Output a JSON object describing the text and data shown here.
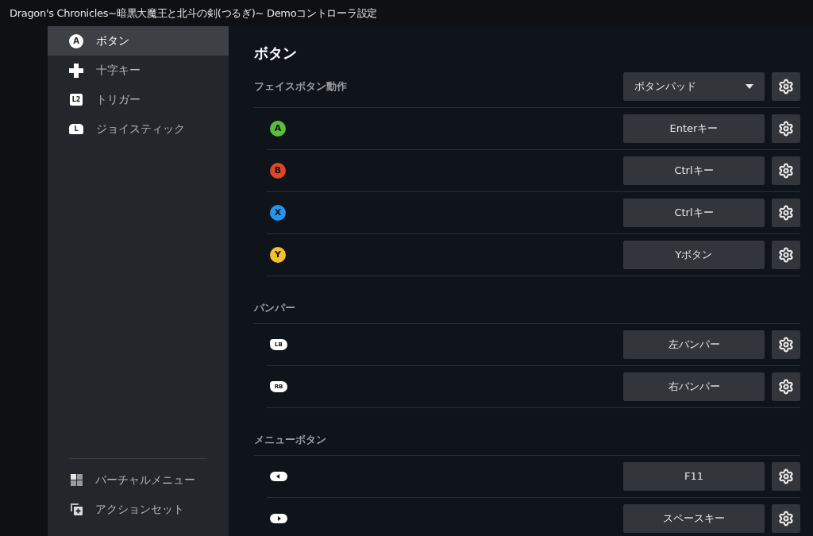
{
  "window": {
    "title": "Dragon's Chronicles~暗黒大魔王と北斗の剣(つるぎ)~ Demoコントローラ設定"
  },
  "sidebar": {
    "items": [
      {
        "kind": "face",
        "glyph": "A",
        "label": "ボタン",
        "selected": true
      },
      {
        "kind": "dpad",
        "label": "十字キー",
        "selected": false
      },
      {
        "kind": "trigger",
        "glyph": "L2",
        "label": "トリガー",
        "selected": false
      },
      {
        "kind": "stick",
        "glyph": "L",
        "label": "ジョイスティック",
        "selected": false
      }
    ],
    "bottom_items": [
      {
        "kind": "grid",
        "label": "バーチャルメニュー"
      },
      {
        "kind": "sets",
        "label": "アクションセット"
      }
    ]
  },
  "main": {
    "title": "ボタン",
    "sections": [
      {
        "title": "フェイスボタン動作",
        "dropdown": {
          "value": "ボタンパッド"
        },
        "rows": [
          {
            "kind": "face",
            "glyph": "A",
            "color": "#5cbf3a",
            "binding": "Enterキー"
          },
          {
            "kind": "face",
            "glyph": "B",
            "color": "#e0452a",
            "binding": "Ctrlキー"
          },
          {
            "kind": "face",
            "glyph": "X",
            "color": "#2596f0",
            "binding": "Ctrlキー"
          },
          {
            "kind": "face",
            "glyph": "Y",
            "color": "#f2c12e",
            "binding": "Yボタン"
          }
        ]
      },
      {
        "title": "バンパー",
        "rows": [
          {
            "kind": "pill",
            "glyph": "LB",
            "binding": "左バンパー"
          },
          {
            "kind": "pill",
            "glyph": "RB",
            "binding": "右バンパー"
          }
        ]
      },
      {
        "title": "メニューボタン",
        "rows": [
          {
            "kind": "back",
            "binding": "F11"
          },
          {
            "kind": "start",
            "binding": "スペースキー"
          }
        ]
      }
    ]
  }
}
